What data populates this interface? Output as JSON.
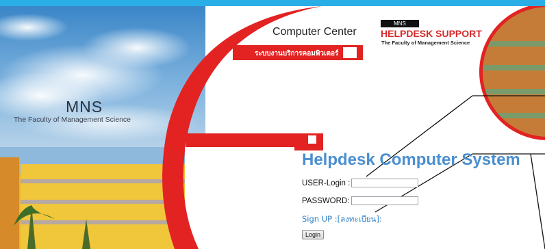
{
  "banner": {
    "org_short": "MNS",
    "org_full": "The Faculty of Management Science",
    "center_title": "Computer Center",
    "center_sub": "ระบบงานบริการคอมพิวเตอร์"
  },
  "logo": {
    "tag": "MNS",
    "title": "HELPDESK SUPPORT",
    "sub": "The Faculty of Management Science"
  },
  "login": {
    "system_title": "Helpdesk Computer System",
    "user_label": "USER-Login :",
    "user_value": "",
    "password_label": "PASSWORD:",
    "password_value": "",
    "signup_link": "Sign UP :[ลงทะเบียน]:",
    "login_button": "Login"
  },
  "colors": {
    "top_bar": "#29aee6",
    "brand_red": "#e32222",
    "title_blue": "#4a8fd0",
    "link_blue": "#2f7fc4"
  }
}
